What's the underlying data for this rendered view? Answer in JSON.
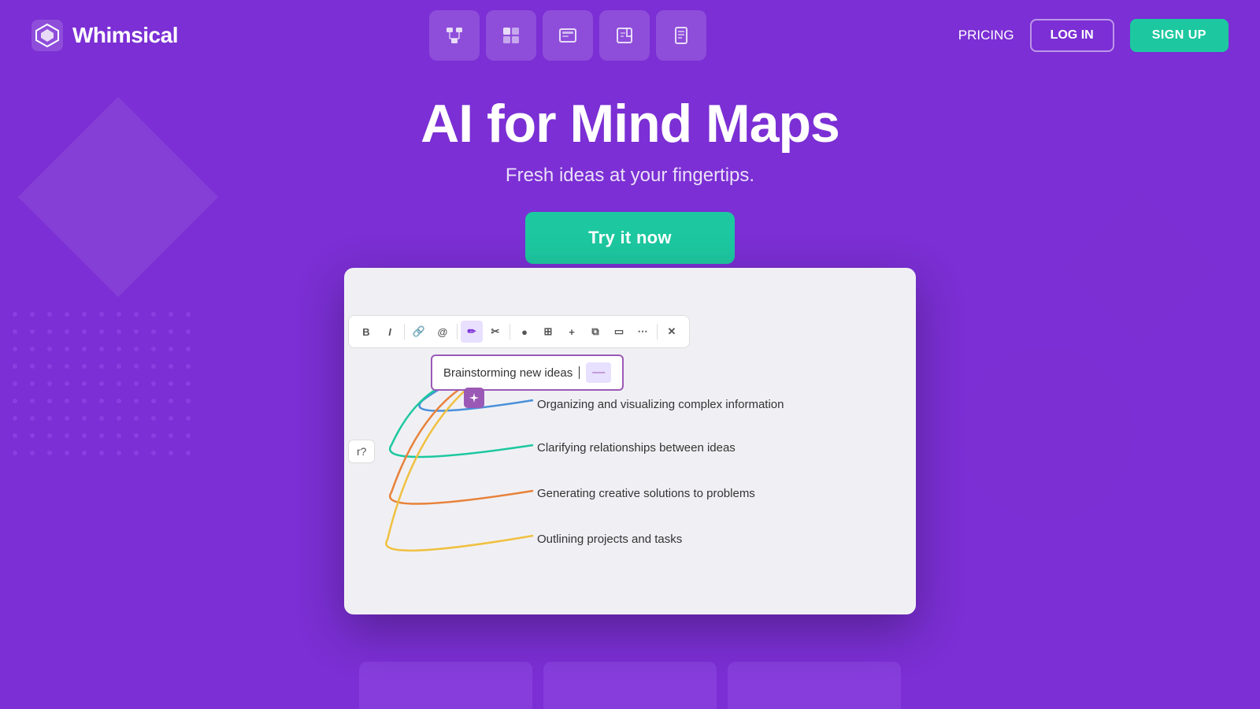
{
  "brand": {
    "name": "Whimsical",
    "logo_alt": "Whimsical logo"
  },
  "nav": {
    "tools": [
      {
        "id": "flowchart",
        "icon": "⊞",
        "label": "Flowchart tool"
      },
      {
        "id": "frames",
        "icon": "▦",
        "label": "Frames tool"
      },
      {
        "id": "wireframe",
        "icon": "⊡",
        "label": "Wireframe tool"
      },
      {
        "id": "sticky",
        "icon": "⊟",
        "label": "Sticky notes tool"
      },
      {
        "id": "docs",
        "icon": "≡",
        "label": "Docs tool"
      }
    ],
    "pricing_label": "PRICING",
    "login_label": "LOG IN",
    "signup_label": "SIGN UP"
  },
  "hero": {
    "title": "AI for Mind Maps",
    "subtitle": "Fresh ideas at your fingertips.",
    "cta_label": "Try it now"
  },
  "demo": {
    "toolbar_items": [
      "B",
      "I",
      "⋯",
      "🔗",
      "@",
      "✏",
      "✂",
      "●",
      "⊞",
      "+",
      "⧉",
      "▭",
      "⋯",
      "✕"
    ],
    "editing_node_text": "Brainstorming new ideas",
    "branches": [
      {
        "label": "Organizing and visualizing complex information",
        "color": "#4A90D9"
      },
      {
        "label": "Clarifying relationships between ideas",
        "color": "#1DC8A0"
      },
      {
        "label": "Generating creative solutions to problems",
        "color": "#E8823A"
      },
      {
        "label": "Outlining projects and tasks",
        "color": "#F0C040"
      }
    ],
    "left_node_text": "r?"
  }
}
